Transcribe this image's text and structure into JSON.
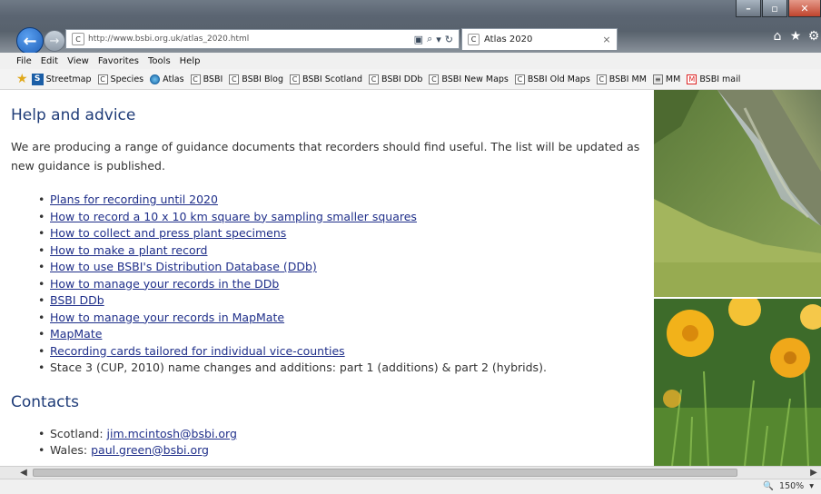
{
  "browser": {
    "address": "http://www.bsbi.org.uk/atlas_2020.html",
    "tab_title": "Atlas 2020",
    "menu": [
      "File",
      "Edit",
      "View",
      "Favorites",
      "Tools",
      "Help"
    ],
    "favorites": [
      {
        "label": "Streetmap",
        "icon": "s-icon"
      },
      {
        "label": "Species",
        "icon": "page-icon"
      },
      {
        "label": "Atlas",
        "icon": "globe-icon"
      },
      {
        "label": "BSBI",
        "icon": "page-icon"
      },
      {
        "label": "BSBI Blog",
        "icon": "page-icon"
      },
      {
        "label": "BSBI Scotland",
        "icon": "page-icon"
      },
      {
        "label": "BSBI DDb",
        "icon": "page-icon"
      },
      {
        "label": "BSBI New Maps",
        "icon": "page-icon"
      },
      {
        "label": "BSBI Old Maps",
        "icon": "page-icon"
      },
      {
        "label": "BSBI MM",
        "icon": "page-icon"
      },
      {
        "label": "MM",
        "icon": "grid-icon"
      },
      {
        "label": "BSBI mail",
        "icon": "gmail-icon"
      }
    ],
    "zoom": "150%"
  },
  "page": {
    "heading": "Help and advice",
    "intro": "We are producing a range of guidance documents that recorders should find useful. The list will be updated as new guidance is published.",
    "links": [
      "Plans for recording until 2020",
      "How to record a 10 x 10 km square by sampling smaller squares",
      "How to collect and press plant specimens",
      "How to make a plant record",
      "How to use BSBI's Distribution Database (DDb)",
      "How to manage your records in the DDb",
      "BSBI DDb",
      "How to manage your records in MapMate",
      "MapMate",
      "Recording cards tailored for individual vice-counties"
    ],
    "plain_item": "Stace 3 (CUP, 2010) name changes and additions: part 1 (additions) & part 2 (hybrids).",
    "contacts_heading": "Contacts",
    "contacts": [
      {
        "label": "Scotland: ",
        "email": "jim.mcintosh@bsbi.org"
      },
      {
        "label": "Wales: ",
        "email": "paul.green@bsbi.org"
      }
    ]
  }
}
